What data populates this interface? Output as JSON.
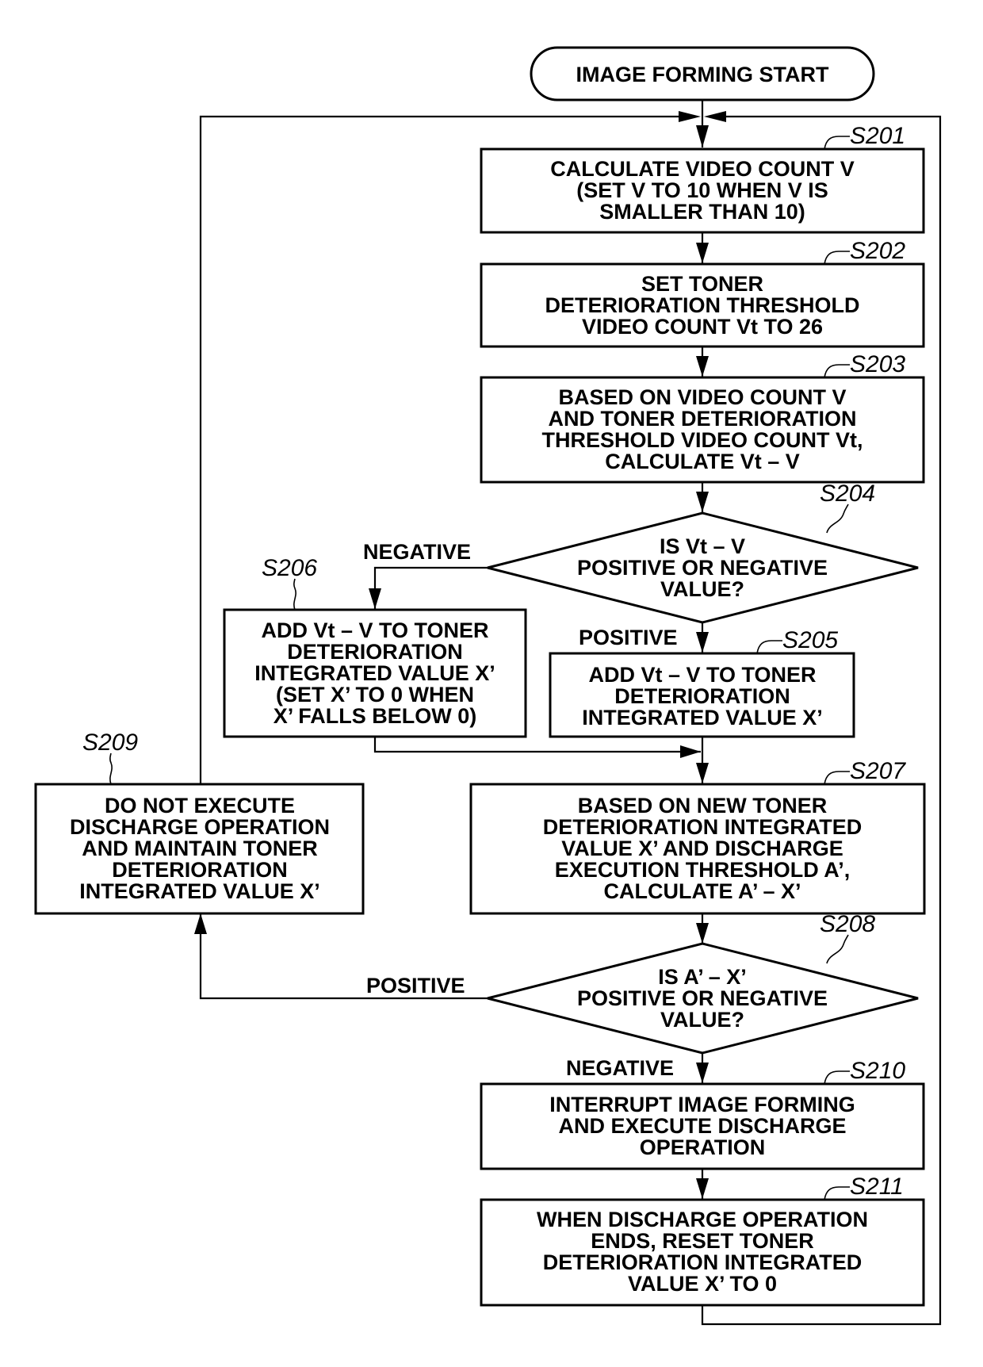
{
  "diagram": {
    "type": "flowchart",
    "start": {
      "text": [
        "IMAGE FORMING START"
      ]
    },
    "steps": {
      "s201": {
        "id": "S201",
        "text": [
          "CALCULATE VIDEO COUNT V",
          "(SET V TO 10 WHEN V IS",
          "SMALLER THAN 10)"
        ]
      },
      "s202": {
        "id": "S202",
        "text": [
          "SET TONER",
          "DETERIORATION THRESHOLD",
          "VIDEO COUNT Vt TO 26"
        ]
      },
      "s203": {
        "id": "S203",
        "text": [
          "BASED ON VIDEO COUNT V",
          "AND TONER DETERIORATION",
          "THRESHOLD VIDEO COUNT Vt,",
          "CALCULATE Vt – V"
        ]
      },
      "s204": {
        "id": "S204",
        "text": [
          "IS Vt – V",
          "POSITIVE OR NEGATIVE",
          "VALUE?"
        ]
      },
      "s205": {
        "id": "S205",
        "text": [
          "ADD Vt – V TO TONER",
          "DETERIORATION",
          "INTEGRATED VALUE X’"
        ]
      },
      "s206": {
        "id": "S206",
        "text": [
          "ADD Vt – V TO TONER",
          "DETERIORATION",
          "INTEGRATED VALUE X’",
          "(SET X’ TO 0 WHEN",
          "X’ FALLS BELOW 0)"
        ]
      },
      "s207": {
        "id": "S207",
        "text": [
          "BASED ON NEW TONER",
          "DETERIORATION INTEGRATED",
          "VALUE X’ AND DISCHARGE",
          "EXECUTION THRESHOLD A’,",
          "CALCULATE A’ – X’"
        ]
      },
      "s208": {
        "id": "S208",
        "text": [
          "IS A’ – X’",
          "POSITIVE OR NEGATIVE",
          "VALUE?"
        ]
      },
      "s209": {
        "id": "S209",
        "text": [
          "DO NOT EXECUTE",
          "DISCHARGE OPERATION",
          "AND MAINTAIN TONER",
          "DETERIORATION",
          "INTEGRATED VALUE X’"
        ]
      },
      "s210": {
        "id": "S210",
        "text": [
          "INTERRUPT IMAGE FORMING",
          "AND EXECUTE DISCHARGE",
          "OPERATION"
        ]
      },
      "s211": {
        "id": "S211",
        "text": [
          "WHEN DISCHARGE OPERATION",
          "ENDS, RESET TONER",
          "DETERIORATION INTEGRATED",
          "VALUE X’ TO 0"
        ]
      }
    },
    "edge_labels": {
      "s204_negative": "NEGATIVE",
      "s204_positive": "POSITIVE",
      "s208_positive": "POSITIVE",
      "s208_negative": "NEGATIVE"
    },
    "edges": [
      {
        "from": "START",
        "to": "S201"
      },
      {
        "from": "S201",
        "to": "S202"
      },
      {
        "from": "S202",
        "to": "S203"
      },
      {
        "from": "S203",
        "to": "S204"
      },
      {
        "from": "S204",
        "to": "S205",
        "label": "POSITIVE"
      },
      {
        "from": "S204",
        "to": "S206",
        "label": "NEGATIVE"
      },
      {
        "from": "S205",
        "to": "S207"
      },
      {
        "from": "S206",
        "to": "S207"
      },
      {
        "from": "S207",
        "to": "S208"
      },
      {
        "from": "S208",
        "to": "S209",
        "label": "POSITIVE"
      },
      {
        "from": "S208",
        "to": "S210",
        "label": "NEGATIVE"
      },
      {
        "from": "S210",
        "to": "S211"
      },
      {
        "from": "S209",
        "to": "S201"
      },
      {
        "from": "S211",
        "to": "S201"
      }
    ]
  }
}
